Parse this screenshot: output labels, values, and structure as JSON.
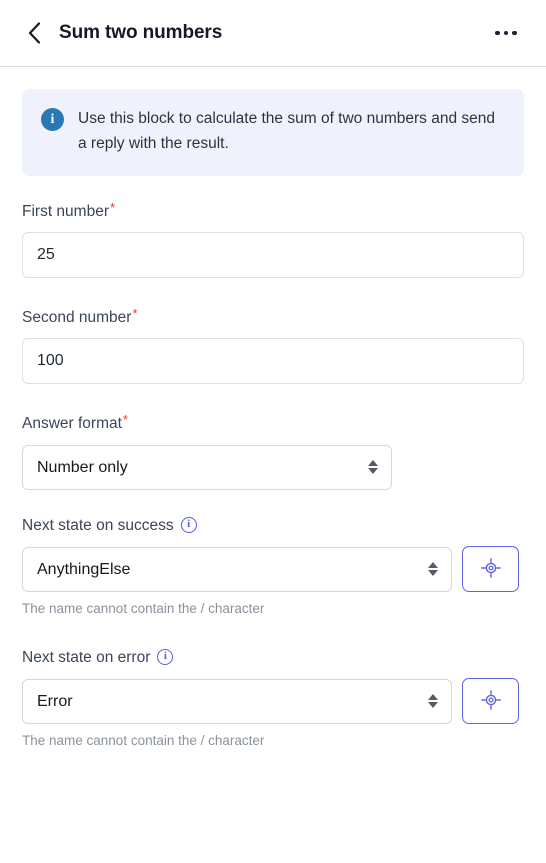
{
  "header": {
    "back_icon": "chevron-left-icon",
    "title": "Sum two numbers",
    "menu_icon": "ellipsis-horizontal-icon"
  },
  "banner": {
    "icon": "info-filled-icon",
    "icon_glyph": "i",
    "text": "Use this block to calculate the sum of two numbers and send a reply with the result.",
    "background_color": "#eff2fa",
    "icon_color": "#2878b5"
  },
  "fields": {
    "first_number": {
      "label": "First number",
      "required_marker": "*",
      "value": "25",
      "placeholder": ""
    },
    "second_number": {
      "label": "Second number",
      "required_marker": "*",
      "value": "100",
      "placeholder": ""
    },
    "answer_format": {
      "label": "Answer format",
      "required_marker": "*",
      "selected": "Number only",
      "options": [
        "Number only"
      ]
    },
    "next_state_success": {
      "label": "Next state on success",
      "info_icon": "info-outline-icon",
      "info_glyph": "i",
      "selected": "AnythingElse",
      "options": [
        "AnythingElse"
      ],
      "helper_text": "The name cannot contain the / character",
      "pick_button_icon": "crosshair-target-icon"
    },
    "next_state_error": {
      "label": "Next state on error",
      "info_icon": "info-outline-icon",
      "info_glyph": "i",
      "selected": "Error",
      "options": [
        "Error"
      ],
      "helper_text": "The name cannot contain the / character",
      "pick_button_icon": "crosshair-target-icon"
    }
  },
  "colors": {
    "accent": "#6161e8",
    "required": "#f0342c",
    "info_blue": "#2878b5",
    "helper_gray": "#8b929e"
  }
}
